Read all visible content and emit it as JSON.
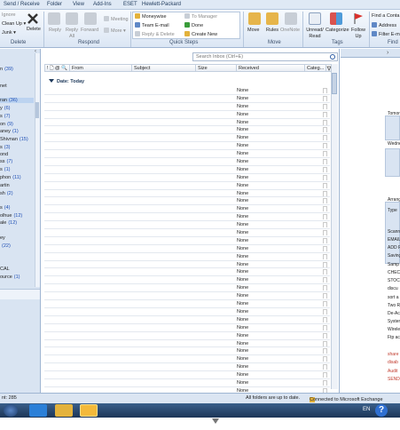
{
  "ribbon_tabs": [
    "Send / Receive",
    "Folder",
    "View",
    "Add-Ins",
    "ESET",
    "Hewlett-Packard"
  ],
  "ribbon": {
    "delete_group": {
      "label": "Delete",
      "ignore": "Ignore",
      "clean_up": "Clean Up ▾",
      "junk": "Junk ▾",
      "delete": "Delete"
    },
    "respond_group": {
      "label": "Respond",
      "reply": "Reply",
      "reply_all": "Reply All",
      "forward": "Forward",
      "meeting": "Meeting",
      "more": "More ▾"
    },
    "quick_steps_group": {
      "label": "Quick Steps",
      "moneywise": "Moneywise",
      "to_manager": "To Manager",
      "team_email": "Team E-mail",
      "done": "Done",
      "reply_delete": "Reply & Delete",
      "create_new": "Create New"
    },
    "move_group": {
      "label": "Move",
      "move": "Move",
      "rules": "Rules",
      "onenote": "OneNote"
    },
    "tags_group": {
      "label": "Tags",
      "unread_read": "Unread/ Read",
      "categorize": "Categorize",
      "follow_up": "Follow Up"
    },
    "find_group": {
      "label": "Find",
      "find_contact": "Find a Conta",
      "address_book": "Address",
      "filter_email": "Filter E-m"
    }
  },
  "nav": {
    "items": [
      {
        "text": "n",
        "count": "(39)"
      },
      {
        "text": "net",
        "count": ""
      },
      {
        "text": "ran",
        "count": "(36)"
      },
      {
        "text": "y",
        "count": "(6)"
      },
      {
        "text": "s",
        "count": "(7)"
      },
      {
        "text": "on",
        "count": "(9)"
      },
      {
        "text": "aney",
        "count": "(1)"
      },
      {
        "text": "Shivnan",
        "count": "(15)"
      },
      {
        "text": "s",
        "count": "(3)"
      },
      {
        "text": "ond",
        "count": ""
      },
      {
        "text": "ss",
        "count": "(7)"
      },
      {
        "text": "s",
        "count": "(1)"
      },
      {
        "text": "phon",
        "count": "(11)"
      },
      {
        "text": "artin",
        "count": ""
      },
      {
        "text": "sh",
        "count": "(2)"
      },
      {
        "text": "s",
        "count": "(4)"
      },
      {
        "text": "olhue",
        "count": "(12)"
      },
      {
        "text": "ale",
        "count": "(12)"
      },
      {
        "text": "ey",
        "count": ""
      },
      {
        "text": "",
        "count": "(22)"
      },
      {
        "text": "CAL",
        "count": ""
      },
      {
        "text": "ource",
        "count": "(1)"
      }
    ],
    "bottom_count": "nt: 285"
  },
  "list": {
    "search_placeholder": "Search Inbox (Ctrl+E)",
    "columns": {
      "from": "From",
      "subject": "Subject",
      "size": "Size",
      "received": "Received",
      "categories": "Categ..."
    },
    "group_header": "Date: Today",
    "received_values": [
      "None",
      "None",
      "None",
      "None",
      "None",
      "None",
      "None",
      "None",
      "None",
      "None",
      "None",
      "None",
      "None",
      "None",
      "None",
      "None",
      "None",
      "None",
      "None",
      "None",
      "None",
      "None",
      "None",
      "None",
      "None",
      "None",
      "None",
      "None",
      "None",
      "None",
      "None",
      "None",
      "None",
      "None",
      "None",
      "None",
      "None",
      "None",
      "None",
      "None",
      "None"
    ]
  },
  "todo": {
    "items": [
      {
        "text": "Tomor",
        "red": false
      },
      {
        "text": "Wedne",
        "red": false
      },
      {
        "text": "Arrang",
        "red": false
      },
      {
        "text": "Type",
        "red": false
      },
      {
        "text": "Scann",
        "red": false
      },
      {
        "text": "EMAIL",
        "red": false
      },
      {
        "text": "ADD F",
        "red": false
      },
      {
        "text": "Saving",
        "red": false
      },
      {
        "text": "Samp",
        "red": false
      },
      {
        "text": "CHEC",
        "red": false
      },
      {
        "text": "STOC",
        "red": false
      },
      {
        "text": "discu",
        "red": false
      },
      {
        "text": "sort a",
        "red": false
      },
      {
        "text": "Two R",
        "red": false
      },
      {
        "text": "De-Ac",
        "red": false
      },
      {
        "text": "Syster",
        "red": false
      },
      {
        "text": "Wirele",
        "red": false
      },
      {
        "text": "Ftp ac",
        "red": false
      },
      {
        "text": "share",
        "red": true
      },
      {
        "text": "disab",
        "red": true
      },
      {
        "text": "Audit",
        "red": true
      },
      {
        "text": "SEND",
        "red": true
      }
    ]
  },
  "status": {
    "left": "nt: 285",
    "up_to_date": "All folders are up to date.",
    "connected": "Connected to Microsoft Exchange"
  },
  "taskbar": {
    "language": "EN",
    "help": "?"
  }
}
